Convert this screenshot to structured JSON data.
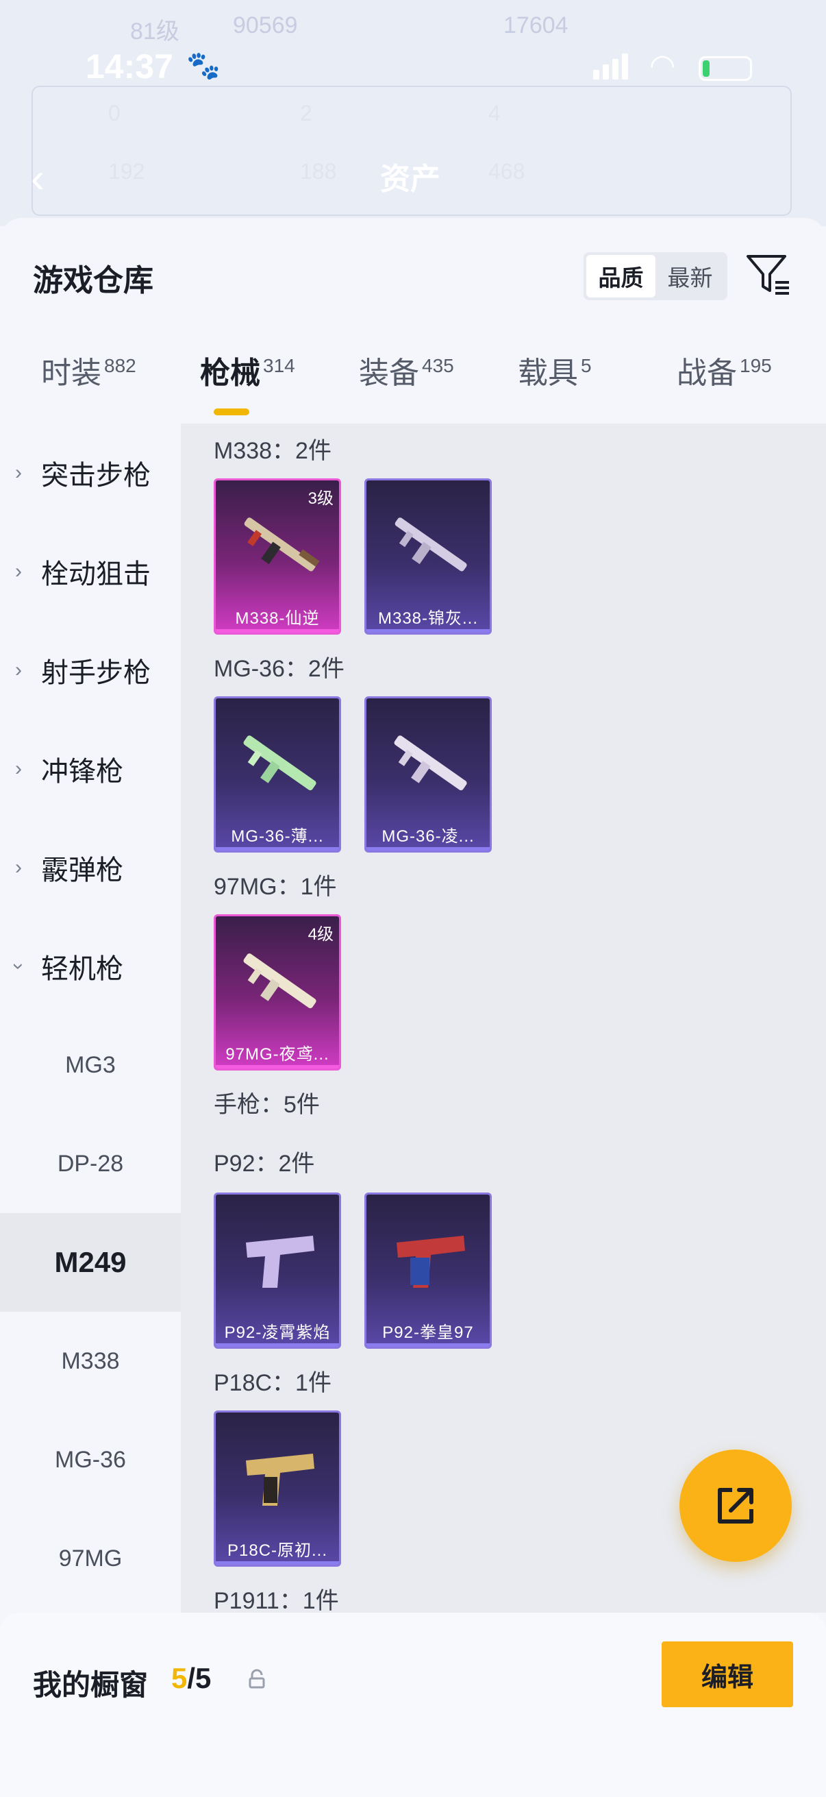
{
  "status_bar": {
    "time": "14:37"
  },
  "background": {
    "title": "资产",
    "row1_left": "81级",
    "row1_views": "90569",
    "row1_right": "17604",
    "stats": [
      "0",
      "2",
      "4",
      "192",
      "188",
      "468"
    ]
  },
  "sheet": {
    "title": "游戏仓库",
    "sort": {
      "options": [
        "品质",
        "最新"
      ],
      "active": "品质"
    }
  },
  "tabs": [
    {
      "label": "时装",
      "count": "882"
    },
    {
      "label": "枪械",
      "count": "314",
      "active": true
    },
    {
      "label": "装备",
      "count": "435"
    },
    {
      "label": "载具",
      "count": "5"
    },
    {
      "label": "战备",
      "count": "195"
    }
  ],
  "categories": [
    {
      "label": "突击步枪"
    },
    {
      "label": "栓动狙击"
    },
    {
      "label": "射手步枪"
    },
    {
      "label": "冲锋枪"
    },
    {
      "label": "霰弹枪"
    },
    {
      "label": "轻机枪",
      "expanded": true
    }
  ],
  "subcategories": [
    {
      "label": "MG3"
    },
    {
      "label": "DP-28"
    },
    {
      "label": "M249",
      "selected": true
    },
    {
      "label": "M338"
    },
    {
      "label": "MG-36"
    },
    {
      "label": "97MG"
    }
  ],
  "groups": {
    "m338": "M338：2件",
    "mg36": "MG-36：2件",
    "mg97": "97MG：1件",
    "pistol": "手枪：5件",
    "p92": "P92：2件",
    "p18c": "P18C：1件",
    "p1911": "P1911：1件"
  },
  "items": {
    "m338_1": {
      "name": "M338-仙逆",
      "level": "3级",
      "rarity": "pink"
    },
    "m338_2": {
      "name": "M338-锦灰...",
      "rarity": "purple"
    },
    "mg36_1": {
      "name": "MG-36-薄...",
      "rarity": "purple"
    },
    "mg36_2": {
      "name": "MG-36-凌...",
      "rarity": "purple"
    },
    "mg97_1": {
      "name": "97MG-夜鸢...",
      "level": "4级",
      "rarity": "pink"
    },
    "p92_1": {
      "name": "P92-凌霄紫焰",
      "rarity": "purple"
    },
    "p92_2": {
      "name": "P92-拳皇97",
      "rarity": "purple"
    },
    "p18c_1": {
      "name": "P18C-原初...",
      "rarity": "purple"
    }
  },
  "showcase": {
    "label": "我的橱窗",
    "current": "5",
    "separator": "/",
    "total": "5",
    "edit_label": "编辑"
  },
  "colors": {
    "accent": "#fbb216",
    "purple_rarity": "#8a78e0",
    "pink_rarity": "#ea58d6"
  },
  "icons": {
    "filter": "filter-icon",
    "fab": "share-icon",
    "lock": "lock-icon",
    "back": "back-arrow-icon"
  }
}
